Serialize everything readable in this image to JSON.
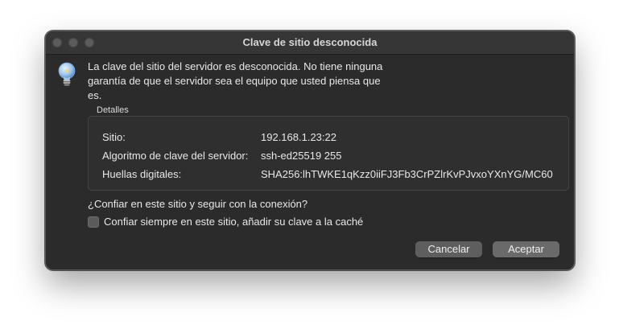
{
  "window": {
    "title": "Clave de sitio desconocida"
  },
  "icon": {
    "name": "lightbulb-icon",
    "color": "#9fc7ef"
  },
  "message": {
    "line1": "La clave del sitio del servidor es desconocida. No tiene ninguna",
    "line2": "garantía de que el servidor sea el equipo que usted piensa que",
    "line3": "es."
  },
  "details": {
    "label": "Detalles",
    "rows": [
      {
        "label": "Sitio:",
        "value": "192.168.1.23:22"
      },
      {
        "label": "Algoritmo de clave del servidor:",
        "value": "ssh-ed25519 255"
      },
      {
        "label": "Huellas digitales:",
        "value": "SHA256:lhTWKE1qKzz0iiFJ3Fb3CrPZlrKvPJvxoYXnYG/MC60"
      }
    ]
  },
  "question": "¿Confiar en este sitio y seguir con la conexión?",
  "checkbox": {
    "label": "Confiar siempre en este sitio, añadir su clave a la caché",
    "checked": false
  },
  "buttons": {
    "cancel": "Cancelar",
    "accept": "Aceptar"
  }
}
